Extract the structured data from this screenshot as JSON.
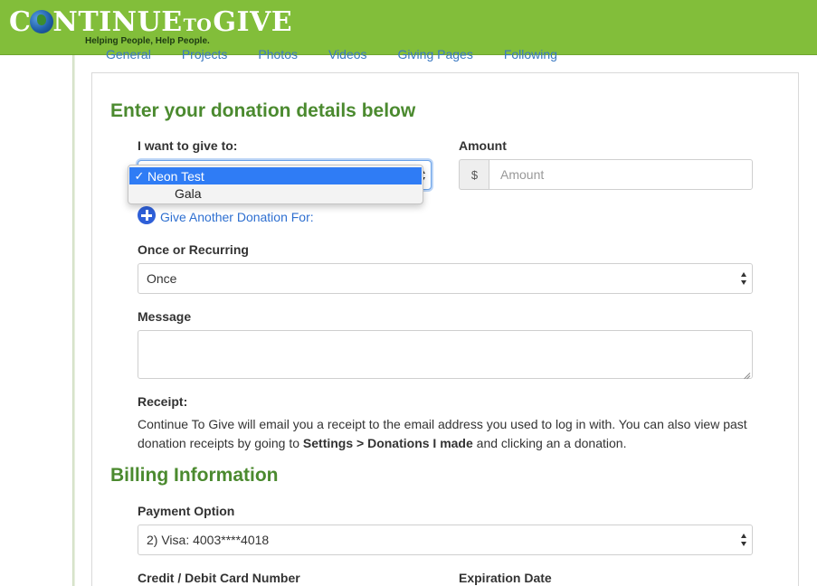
{
  "header": {
    "logo_main_a": "C",
    "logo_main_b": "NTINUE",
    "logo_to": "TO",
    "logo_give": "GIVE",
    "tagline": "Helping People, Help People.",
    "brand_color": "#82be3a"
  },
  "tabs": [
    "General",
    "Projects",
    "Photos",
    "Videos",
    "Giving Pages",
    "Following"
  ],
  "donation": {
    "heading": "Enter your donation details below",
    "give_to_label": "I want to give to:",
    "give_to_options": [
      {
        "label": "Neon Test",
        "selected": true
      },
      {
        "label": "Gala",
        "selected": false
      }
    ],
    "checkmark": "✓",
    "amount_label": "Amount",
    "currency_symbol": "$",
    "amount_placeholder": "Amount",
    "give_another": "Give Another Donation For:",
    "recurring_label": "Once or Recurring",
    "recurring_value": "Once",
    "message_label": "Message",
    "receipt_label": "Receipt:",
    "receipt_text_1": "Continue To Give will email you a receipt to the email address you used to log in with. You can also view past donation receipts by going to ",
    "receipt_bold": "Settings > Donations I made",
    "receipt_text_2": " and clicking an a donation."
  },
  "billing": {
    "heading": "Billing Information",
    "payment_option_label": "Payment Option",
    "payment_option_value": "2) Visa: 4003****4018",
    "card_number_label": "Credit / Debit Card Number",
    "expiration_label": "Expiration Date"
  },
  "colors": {
    "heading_green": "#4b8a2f",
    "link_blue": "#2e6fd0",
    "selected_blue": "#2f7cf5"
  }
}
